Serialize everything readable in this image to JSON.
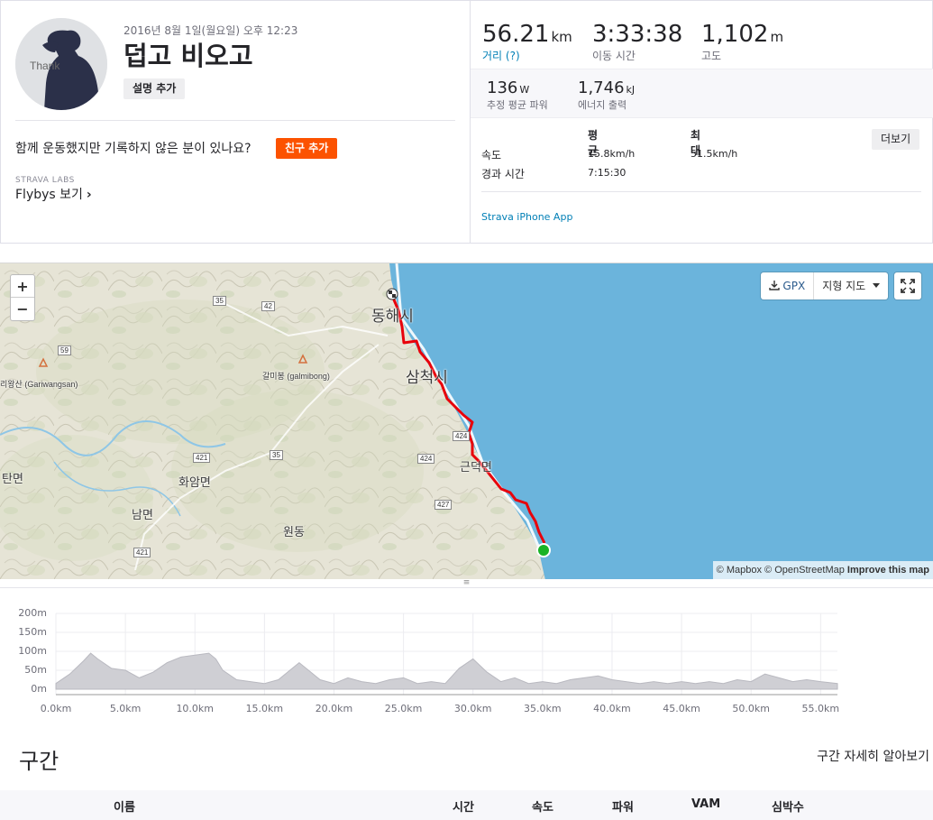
{
  "activity": {
    "date": "2016년 8월 1일(월요일) 오후 12:23",
    "title": "덥고 비오고",
    "add_description": "설명 추가",
    "avatar_text": "Thank",
    "friends_question": "함께 운동했지만 기록하지 않은 분이 있나요?",
    "add_friends": "친구 추가",
    "labs_label": "STRAVA LABS",
    "flybys_label": "Flybys 보기",
    "flybys_chevron": "›"
  },
  "stats": {
    "distance": {
      "value": "56.21",
      "unit": "km",
      "label": "거리 (?)"
    },
    "moving_time": {
      "value": "3:33:38",
      "label": "이동 시간"
    },
    "elevation": {
      "value": "1,102",
      "unit": "m",
      "label": "고도"
    },
    "power": {
      "value": "136",
      "unit": "W",
      "label": "추정 평균 파워"
    },
    "energy": {
      "value": "1,746",
      "unit": "kJ",
      "label": "에너지 출력"
    }
  },
  "more_stats": {
    "headers": [
      "평균",
      "최대"
    ],
    "rows": [
      {
        "label": "속도",
        "avg": "15.8km/h",
        "max": "51.5km/h"
      },
      {
        "label": "경과 시간",
        "avg": "7:15:30",
        "max": ""
      }
    ],
    "more_button": "더보기",
    "device": "Strava iPhone App"
  },
  "map": {
    "zoom_in": "+",
    "zoom_out": "−",
    "gpx_label": "GPX",
    "terrain_label": "지형 지도",
    "attribution_mapbox": "© Mapbox",
    "attribution_osm": "© OpenStreetMap",
    "attribution_improve": "Improve this map",
    "places": [
      "동해시",
      "삼척시",
      "근덕면",
      "화암면",
      "남면",
      "원동",
      "탄면",
      "갈미봉 (galmibong)",
      "리왕산 (Gariwangsan)"
    ],
    "roads": [
      "35",
      "42",
      "59",
      "421",
      "35",
      "424",
      "424",
      "427",
      "421"
    ],
    "colors": {
      "sea": "#6bb4dc",
      "land": "#e8e6d9",
      "route": "#e8000b",
      "start": "#19b326"
    },
    "resize_handle": "≡"
  },
  "elevation_chart": {
    "y_ticks": [
      "200m",
      "150m",
      "100m",
      "50m",
      "0m"
    ],
    "x_ticks": [
      "0.0km",
      "5.0km",
      "10.0km",
      "15.0km",
      "20.0km",
      "25.0km",
      "30.0km",
      "35.0km",
      "40.0km",
      "45.0km",
      "50.0km",
      "55.0km"
    ]
  },
  "chart_data": {
    "type": "area",
    "xlabel": "",
    "ylabel": "",
    "ylim": [
      0,
      200
    ],
    "xlim": [
      0,
      56.21
    ],
    "x": [
      0,
      1,
      2,
      2.5,
      3,
      4,
      5,
      6,
      7,
      8,
      9,
      10,
      11,
      11.5,
      12,
      13,
      14,
      15,
      16,
      17,
      17.5,
      18,
      19,
      20,
      21,
      22,
      23,
      24,
      25,
      26,
      27,
      28,
      29,
      30,
      31,
      32,
      33,
      34,
      35,
      36,
      37,
      38,
      39,
      40,
      41,
      42,
      43,
      44,
      45,
      46,
      47,
      48,
      49,
      50,
      51,
      52,
      53,
      54,
      55,
      56.21
    ],
    "series": [
      {
        "values": [
          15,
          40,
          75,
          95,
          80,
          55,
          50,
          30,
          45,
          70,
          85,
          90,
          95,
          80,
          50,
          25,
          20,
          15,
          25,
          55,
          70,
          55,
          25,
          15,
          30,
          20,
          15,
          25,
          30,
          15,
          20,
          15,
          55,
          80,
          45,
          20,
          30,
          15,
          20,
          15,
          25,
          30,
          35,
          25,
          20,
          15,
          20,
          15,
          20,
          15,
          20,
          15,
          25,
          20,
          40,
          30,
          20,
          25,
          20,
          15
        ]
      }
    ]
  },
  "segments": {
    "title": "구간",
    "details_link": "구간 자세히 알아보기",
    "columns": [
      "이름",
      "시간",
      "속도",
      "파워",
      "VAM",
      "심박수"
    ]
  }
}
